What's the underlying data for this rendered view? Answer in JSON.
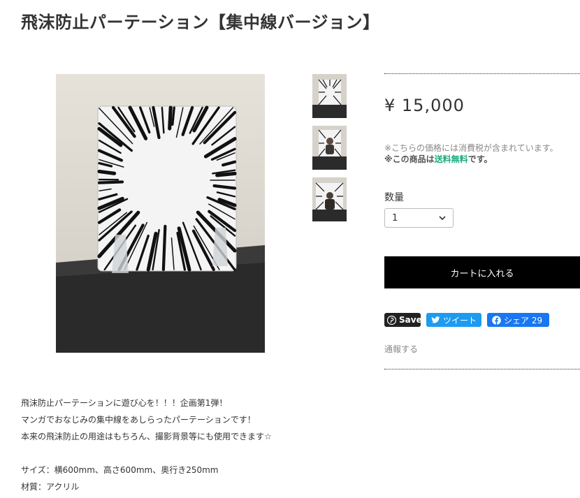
{
  "product": {
    "title": "飛沫防止パーテーション【集中線バージョン】",
    "price": "¥ 15,000",
    "tax_note": "※こちらの価格には消費税が含まれています。",
    "shipping_prefix": "※この商品は",
    "shipping_free": "送料無料",
    "shipping_suffix": "です。",
    "quantity_label": "数量",
    "quantity_value": "1",
    "cart_label": "カートに入れる",
    "report_label": "通報する"
  },
  "share": {
    "pinterest_label": "Save",
    "twitter_label": "ツイート",
    "facebook_label": "シェア 29"
  },
  "description": {
    "lines": [
      "飛沫防止パーテーションに遊び心を！！！企画第1弾！",
      "マンガでおなじみの集中線をあしらったパーテーションです！",
      "本来の飛沫防止の用途はもちろん、撮影背景等にも使用できます☆",
      "",
      "サイズ：横600mm、高さ600mm、奥行き250mm",
      "材質：アクリル"
    ]
  },
  "images": {
    "main": "partition-photo",
    "thumbnails": [
      "partition-thumbnail-1",
      "partition-thumbnail-2",
      "partition-thumbnail-3"
    ]
  },
  "colors": {
    "text": "#333333",
    "free_shipping": "#1eaa80",
    "cart_button": "#000000",
    "twitter": "#1d9bf0",
    "facebook": "#1877f2",
    "pinterest": "#222222"
  }
}
